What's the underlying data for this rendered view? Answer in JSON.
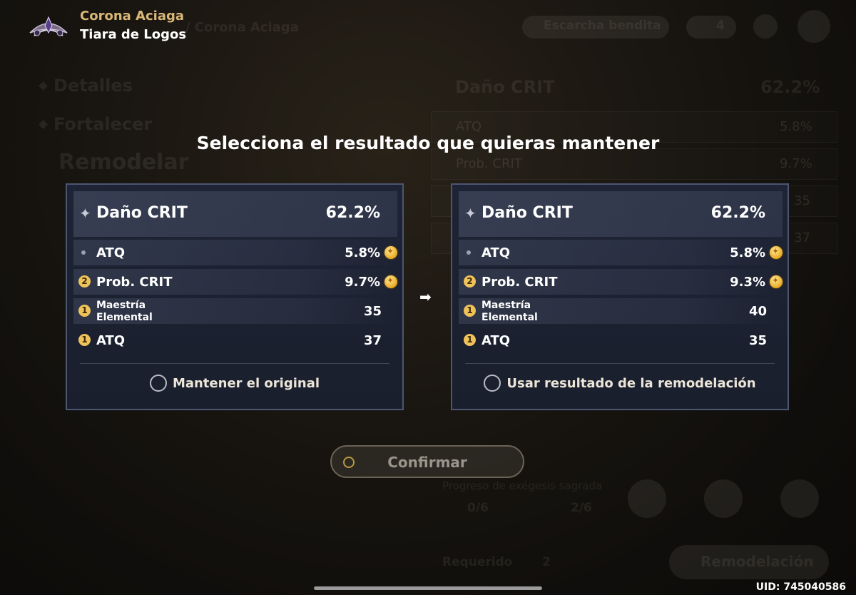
{
  "header": {
    "title": "Corona Aciaga",
    "subtitle": "Tiara de Logos"
  },
  "background": {
    "breadcrumb": "/ Corona Aciaga",
    "blessed_frost_label": "Escarcha bendita",
    "resource_count": "4",
    "nav_details": "Detalles",
    "nav_enhance": "Fortalecer",
    "nav_reshape": "Remodelar",
    "main_stat_name": "Daño CRIT",
    "main_stat_value": "62.2%",
    "stat1_name": "ATQ",
    "stat1_value": "5.8%",
    "stat2_name": "Prob. CRIT",
    "stat2_value": "9.7%",
    "stat3_value": "35",
    "stat4_value": "37",
    "progress_label": "Progreso de exégesis sagrada",
    "progress_current": "0/6",
    "progress_next": "2/6",
    "required_label": "Requerido",
    "required_count": "2",
    "reshape_button": "Remodelación"
  },
  "dialog": {
    "title": "Selecciona el resultado que quieras mantener",
    "original": {
      "main_stat": {
        "name": "Daño CRIT",
        "value": "62.2%"
      },
      "substats": [
        {
          "badge": "",
          "name": "ATQ",
          "value": "5.8%",
          "coin": true
        },
        {
          "badge": "2",
          "name": "Prob. CRIT",
          "value": "9.7%",
          "coin": true
        },
        {
          "badge": "1",
          "name": "Maestría\nElemental",
          "value": "35",
          "coin": false
        },
        {
          "badge": "1",
          "name": "ATQ",
          "value": "37",
          "coin": false
        }
      ],
      "option_label": "Mantener el original"
    },
    "reshaped": {
      "main_stat": {
        "name": "Daño CRIT",
        "value": "62.2%"
      },
      "substats": [
        {
          "badge": "",
          "name": "ATQ",
          "value": "5.8%",
          "coin": true
        },
        {
          "badge": "2",
          "name": "Prob. CRIT",
          "value": "9.3%",
          "coin": true
        },
        {
          "badge": "1",
          "name": "Maestría\nElemental",
          "value": "40",
          "coin": false
        },
        {
          "badge": "1",
          "name": "ATQ",
          "value": "35",
          "coin": false
        }
      ],
      "option_label": "Usar resultado de la remodelación"
    },
    "confirm_label": "Confirmar"
  },
  "footer": {
    "uid": "UID: 745040586"
  },
  "colors": {
    "accent_gold": "#d9b777",
    "card_border": "#4b5670",
    "badge_yellow": "#f0c35a"
  }
}
